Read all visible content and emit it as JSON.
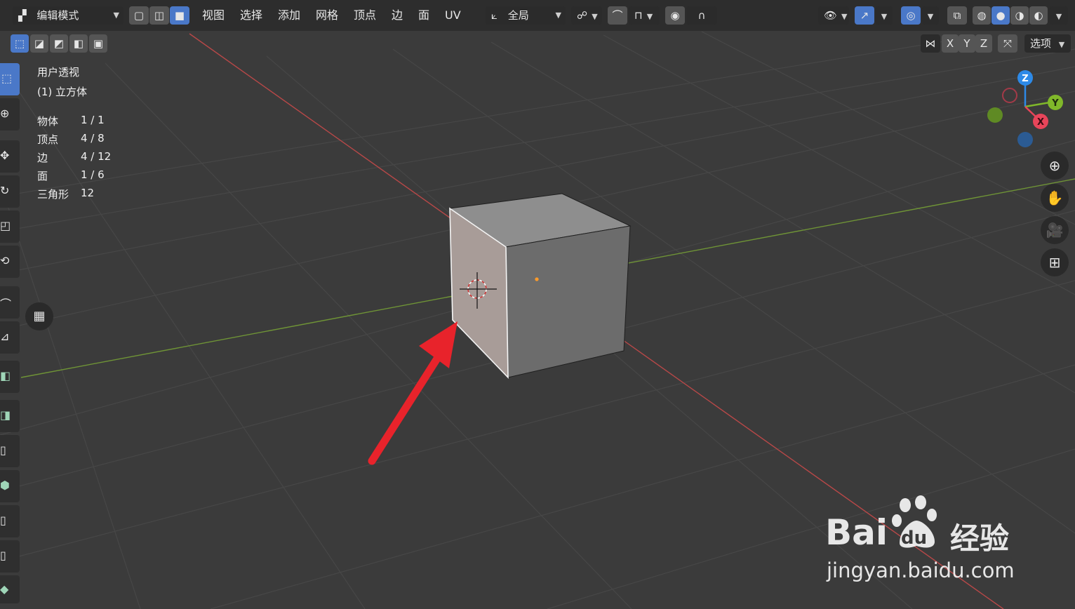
{
  "header": {
    "mode_label": "编辑模式",
    "menus": [
      "视图",
      "选择",
      "添加",
      "网格",
      "顶点",
      "边",
      "面",
      "UV"
    ],
    "transform_orientation": "全局"
  },
  "subheader": {
    "axes": [
      "X",
      "Y",
      "Z"
    ],
    "options_label": "选项"
  },
  "overlay": {
    "view_name": "用户透视",
    "object_name": "(1) 立方体",
    "stats": [
      {
        "label": "物体",
        "value": "1 / 1"
      },
      {
        "label": "顶点",
        "value": "4 / 8"
      },
      {
        "label": "边",
        "value": "4 / 12"
      },
      {
        "label": "面",
        "value": "1 / 6"
      },
      {
        "label": "三角形",
        "value": "12"
      }
    ]
  },
  "gizmo": {
    "z": "Z",
    "y": "Y",
    "x": "X"
  },
  "watermark": {
    "brand_latin": "Bai",
    "brand_du": "du",
    "brand_cn": "经验",
    "url": "jingyan.baidu.com"
  },
  "colors": {
    "active_blue": "#4a78c8",
    "grid_line": "#4a4a4a",
    "x_axis": "#c24a4a",
    "y_axis": "#7aa03a",
    "gizmo_x": "#e8455a",
    "gizmo_y": "#80b82a",
    "gizmo_z": "#2d8ae8",
    "arrow": "#e8232b"
  }
}
